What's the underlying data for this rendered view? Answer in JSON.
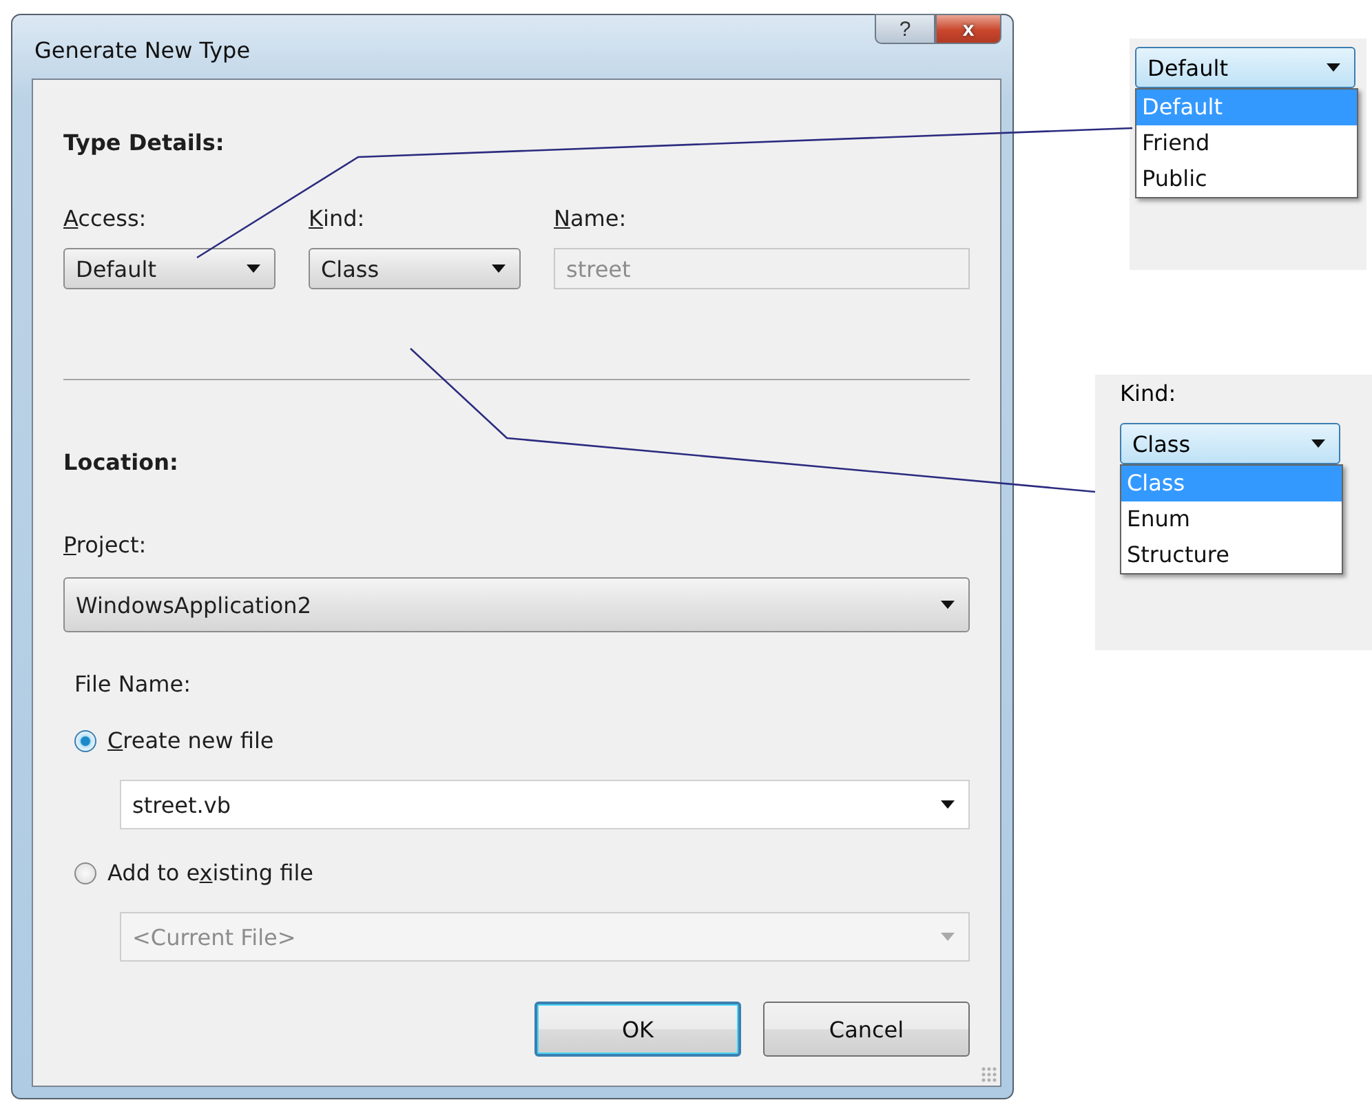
{
  "window": {
    "title": "Generate New Type",
    "title_buttons": [
      {
        "kind": "help",
        "label": "?"
      },
      {
        "kind": "close",
        "label": "x"
      }
    ]
  },
  "type_details": {
    "heading": "Type Details:",
    "access": {
      "label": [
        {
          "text": "A",
          "underline": true
        },
        {
          "text": "ccess:",
          "underline": false
        }
      ],
      "value": "Default"
    },
    "kind": {
      "label": [
        {
          "text": "K",
          "underline": true
        },
        {
          "text": "ind:",
          "underline": false
        }
      ],
      "value": "Class"
    },
    "name": {
      "label": [
        {
          "text": "N",
          "underline": true
        },
        {
          "text": "ame:",
          "underline": false
        }
      ],
      "value": "street",
      "disabled": true
    }
  },
  "location": {
    "heading": "Location:",
    "project": {
      "label": [
        {
          "text": "P",
          "underline": true
        },
        {
          "text": "roject:",
          "underline": false
        }
      ],
      "value": "WindowsApplication2"
    },
    "file_name": {
      "label": "File Name:",
      "options": [
        {
          "label": [
            {
              "text": "C",
              "underline": true
            },
            {
              "text": "reate new file",
              "underline": false
            }
          ],
          "selected": true,
          "value": "street.vb",
          "disabled": false
        },
        {
          "label": [
            {
              "text": "Add to e",
              "underline": false
            },
            {
              "text": "x",
              "underline": true
            },
            {
              "text": "isting file",
              "underline": false
            }
          ],
          "selected": false,
          "value": "<Current File>",
          "disabled": true
        }
      ]
    }
  },
  "buttons": [
    {
      "label": "OK",
      "default": true
    },
    {
      "label": "Cancel",
      "default": false
    }
  ],
  "callouts": [
    {
      "kind": "access",
      "value": "Default",
      "items": [
        {
          "label": "Default",
          "selected": true
        },
        {
          "label": "Friend",
          "selected": false
        },
        {
          "label": "Public",
          "selected": false
        }
      ]
    },
    {
      "kind": "kind",
      "caption": "Kind:",
      "value": "Class",
      "items": [
        {
          "label": "Class",
          "selected": true
        },
        {
          "label": "Enum",
          "selected": false
        },
        {
          "label": "Structure",
          "selected": false
        }
      ]
    }
  ]
}
